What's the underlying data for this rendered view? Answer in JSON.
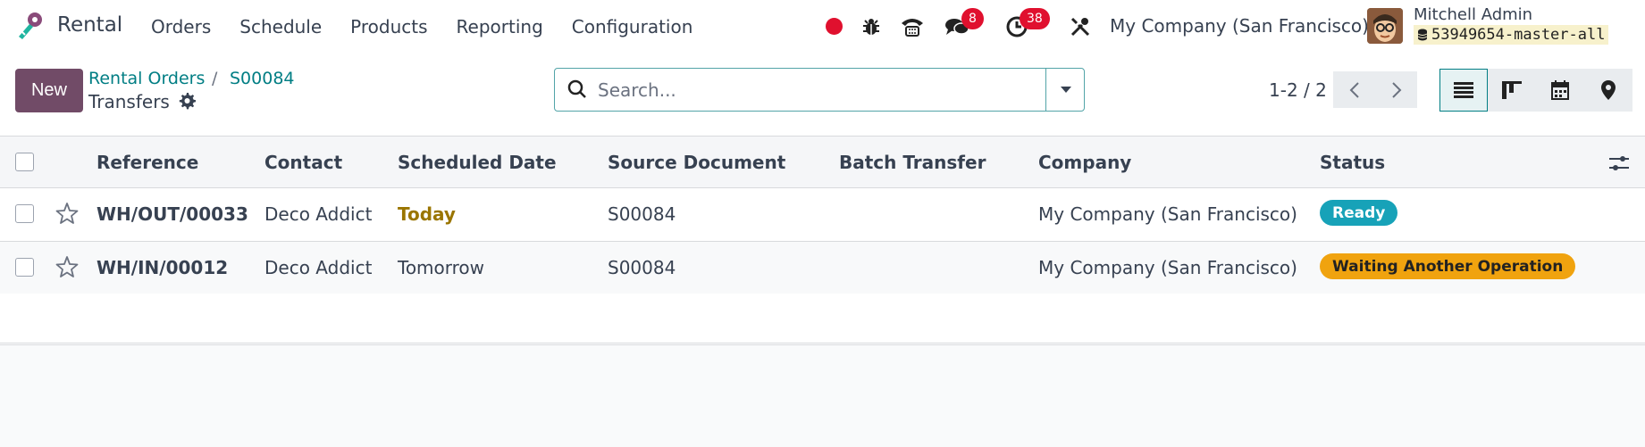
{
  "app": {
    "name": "Rental"
  },
  "menu": [
    "Orders",
    "Schedule",
    "Products",
    "Reporting",
    "Configuration"
  ],
  "systray": {
    "messages_badge": "8",
    "activities_badge": "38",
    "company": "My Company (San Francisco)",
    "user_name": "Mitchell Admin",
    "database": "53949654-master-all"
  },
  "control": {
    "new_label": "New",
    "breadcrumb_parent": "Rental Orders",
    "breadcrumb_separator": "/",
    "breadcrumb_current": "S00084",
    "title": "Transfers",
    "search_placeholder": "Search...",
    "pager": "1-2 / 2"
  },
  "table": {
    "columns": [
      "Reference",
      "Contact",
      "Scheduled Date",
      "Source Document",
      "Batch Transfer",
      "Company",
      "Status"
    ],
    "rows": [
      {
        "reference": "WH/OUT/00033",
        "contact": "Deco Addict",
        "scheduled": "Today",
        "source": "S00084",
        "batch": "",
        "company": "My Company (San Francisco)",
        "status": "Ready"
      },
      {
        "reference": "WH/IN/00012",
        "contact": "Deco Addict",
        "scheduled": "Tomorrow",
        "source": "S00084",
        "batch": "",
        "company": "My Company (San Francisco)",
        "status": "Waiting Another Operation"
      }
    ]
  },
  "colors": {
    "primary": "#714b67",
    "link": "#017e84",
    "badge": "#e0102e",
    "ready": "#17a2b8",
    "waiting": "#f0a30f",
    "today": "#9a7500"
  },
  "icons": [
    "rental-logo-icon",
    "record-icon",
    "bug-icon",
    "phone-icon",
    "chat-icon",
    "clock-icon",
    "tools-icon",
    "database-icon",
    "gear-icon",
    "search-icon",
    "caret-down-icon",
    "chevron-left-icon",
    "chevron-right-icon",
    "list-view-icon",
    "kanban-view-icon",
    "calendar-view-icon",
    "map-view-icon",
    "star-icon",
    "optional-columns-icon"
  ]
}
